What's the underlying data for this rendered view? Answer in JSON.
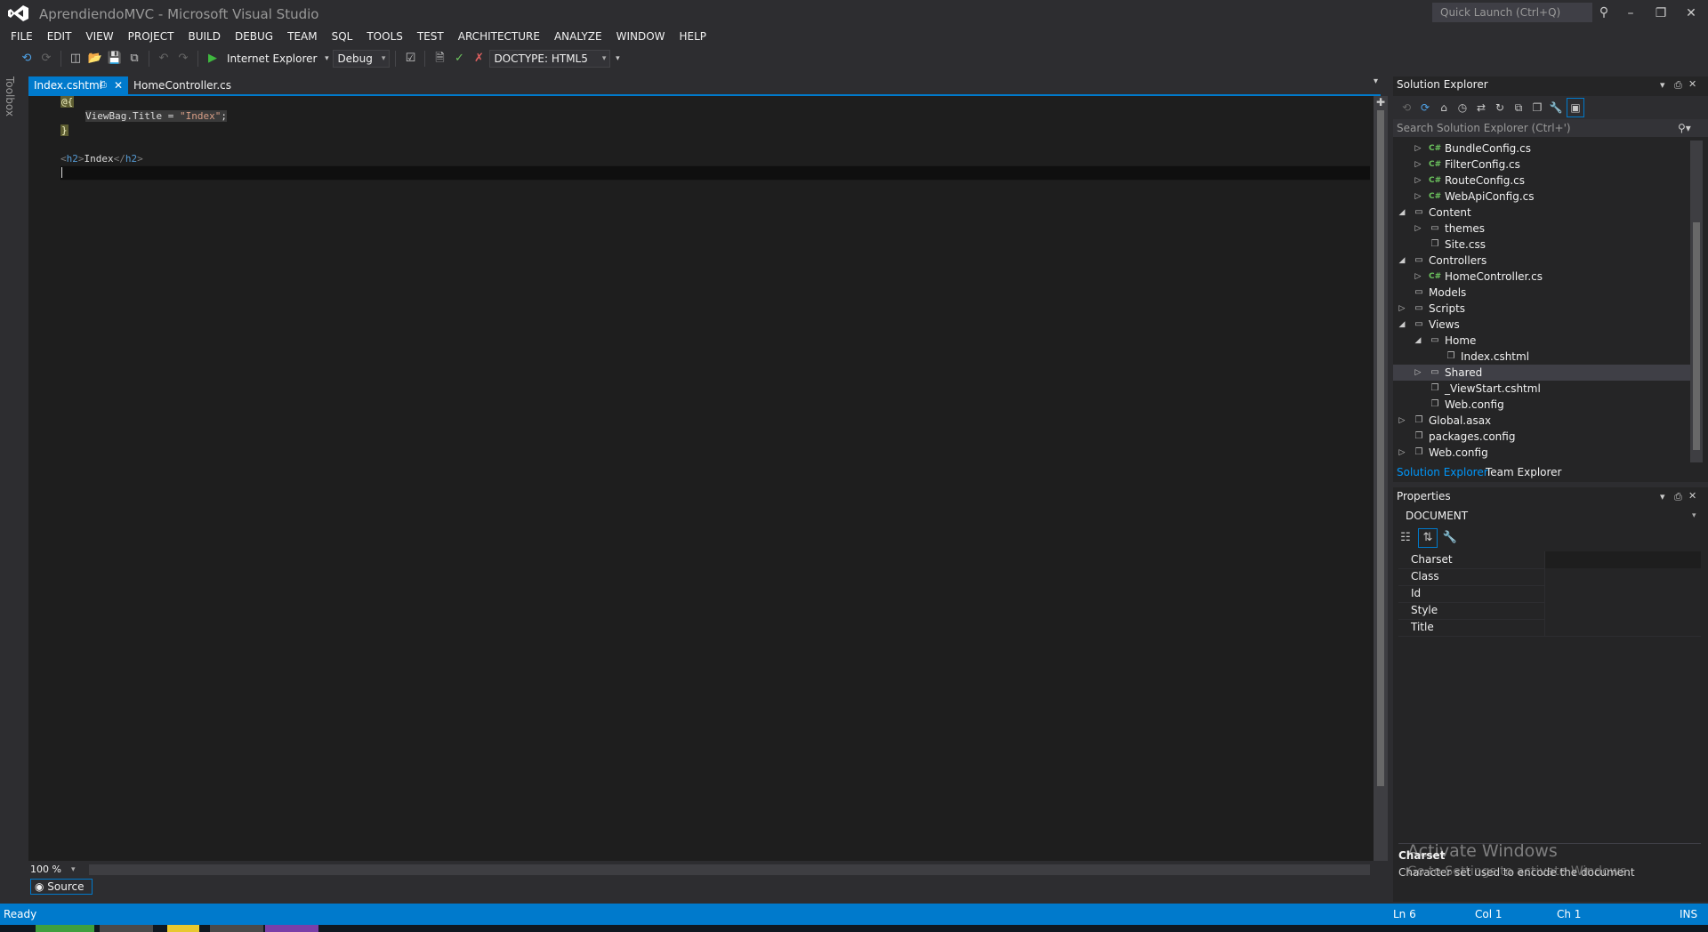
{
  "window": {
    "title": "AprendiendoMVC - Microsoft Visual Studio",
    "quick_launch_placeholder": "Quick Launch (Ctrl+Q)"
  },
  "menu": [
    "FILE",
    "EDIT",
    "VIEW",
    "PROJECT",
    "BUILD",
    "DEBUG",
    "TEAM",
    "SQL",
    "TOOLS",
    "TEST",
    "ARCHITECTURE",
    "ANALYZE",
    "WINDOW",
    "HELP"
  ],
  "toolbar": {
    "run_target": "Internet Explorer",
    "configuration": "Debug",
    "doctype": "DOCTYPE: HTML5"
  },
  "toolbox": {
    "label": "Toolbox"
  },
  "tabs": [
    {
      "label": "Index.cshtml",
      "active": true
    },
    {
      "label": "HomeController.cs",
      "active": false
    }
  ],
  "code": {
    "line1_at": "@{",
    "line2_ident": "ViewBag.Title = ",
    "line2_str": "\"Index\"",
    "line2_end": ";",
    "line3": "}",
    "line5_open": "<",
    "line5_tag": "h2",
    "line5_close": ">",
    "line5_text": "Index",
    "line5_end_open": "</",
    "line5_end_tag": "h2",
    "line5_end_close": ">"
  },
  "editor": {
    "zoom": "100 %",
    "source_tab": "Source"
  },
  "status": {
    "left": "Ready",
    "line": "Ln 6",
    "col": "Col 1",
    "ch": "Ch 1",
    "mode": "INS"
  },
  "solution_explorer": {
    "title": "Solution Explorer",
    "search_placeholder": "Search Solution Explorer (Ctrl+')",
    "items": [
      {
        "label": "BundleConfig.cs",
        "type": "cs",
        "level": 2,
        "arrow": "collapsed"
      },
      {
        "label": "FilterConfig.cs",
        "type": "cs",
        "level": 2,
        "arrow": "collapsed"
      },
      {
        "label": "RouteConfig.cs",
        "type": "cs",
        "level": 2,
        "arrow": "collapsed"
      },
      {
        "label": "WebApiConfig.cs",
        "type": "cs",
        "level": 2,
        "arrow": "collapsed"
      },
      {
        "label": "Content",
        "type": "folder",
        "level": 1,
        "arrow": "expanded"
      },
      {
        "label": "themes",
        "type": "folder",
        "level": 2,
        "arrow": "collapsed"
      },
      {
        "label": "Site.css",
        "type": "file",
        "level": 2,
        "arrow": "none"
      },
      {
        "label": "Controllers",
        "type": "folder",
        "level": 1,
        "arrow": "expanded"
      },
      {
        "label": "HomeController.cs",
        "type": "cs",
        "level": 2,
        "arrow": "collapsed"
      },
      {
        "label": "Models",
        "type": "folder",
        "level": 1,
        "arrow": "none"
      },
      {
        "label": "Scripts",
        "type": "folder",
        "level": 1,
        "arrow": "collapsed"
      },
      {
        "label": "Views",
        "type": "folder",
        "level": 1,
        "arrow": "expanded"
      },
      {
        "label": "Home",
        "type": "folder",
        "level": 2,
        "arrow": "expanded"
      },
      {
        "label": "Index.cshtml",
        "type": "file",
        "level": 3,
        "arrow": "none"
      },
      {
        "label": "Shared",
        "type": "folder",
        "level": 2,
        "arrow": "collapsed",
        "selected": true
      },
      {
        "label": "_ViewStart.cshtml",
        "type": "file",
        "level": 2,
        "arrow": "none"
      },
      {
        "label": "Web.config",
        "type": "file",
        "level": 2,
        "arrow": "none"
      },
      {
        "label": "Global.asax",
        "type": "file",
        "level": 1,
        "arrow": "collapsed"
      },
      {
        "label": "packages.config",
        "type": "file",
        "level": 1,
        "arrow": "none"
      },
      {
        "label": "Web.config",
        "type": "file",
        "level": 1,
        "arrow": "collapsed"
      }
    ],
    "bottom_tabs": [
      "Solution Explorer",
      "Team Explorer"
    ]
  },
  "properties": {
    "title": "Properties",
    "object": "DOCUMENT",
    "rows": [
      "Charset",
      "Class",
      "Id",
      "Style",
      "Title"
    ],
    "description_title": "Charset",
    "description_text": "Character set used to encode the document"
  },
  "watermark": {
    "line1": "Activate Windows",
    "line2": "Go to Settings to activate Windows."
  },
  "colors": {
    "accent": "#007acc",
    "background": "#2d2d30",
    "editor": "#1e1e1e"
  }
}
